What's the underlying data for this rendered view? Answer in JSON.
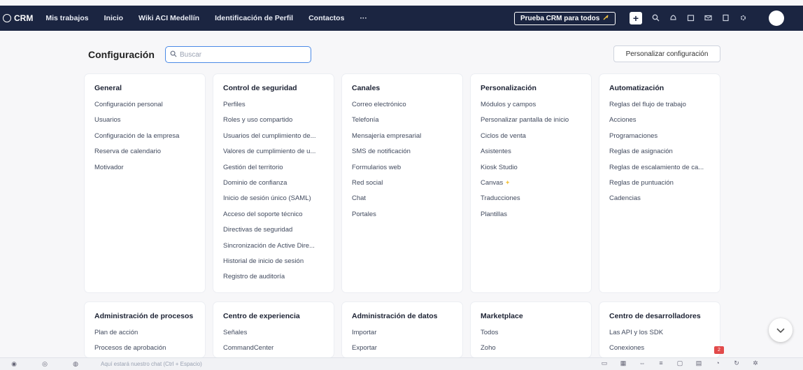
{
  "topbar": {
    "brand": "CRM",
    "nav": [
      "Mis trabajos",
      "Inicio",
      "Wiki ACI Medellín",
      "Identificación de Perfil",
      "Contactos",
      "···"
    ],
    "trial_button": "Prueba CRM para todos",
    "trial_icon": "rocket-icon",
    "add_label": "+",
    "icons": [
      "search-icon",
      "bell-icon",
      "calendar-icon",
      "mail-icon",
      "list-icon",
      "gear-icon"
    ]
  },
  "header": {
    "title": "Configuración",
    "search_placeholder": "Buscar",
    "customize_button": "Personalizar configuración"
  },
  "cards_row1": [
    {
      "title": "General",
      "items": [
        "Configuración personal",
        "Usuarios",
        "Configuración de la empresa",
        "Reserva de calendario",
        "Motivador"
      ]
    },
    {
      "title": "Control de seguridad",
      "items": [
        "Perfiles",
        "Roles y uso compartido",
        "Usuarios del cumplimiento de...",
        "Valores de cumplimiento de u...",
        "Gestión del territorio",
        "Dominio de confianza",
        "Inicio de sesión único (SAML)",
        "Acceso del soporte técnico",
        "Directivas de seguridad",
        "Sincronización de Active Dire...",
        "Historial de inicio de sesión",
        "Registro de auditoría"
      ]
    },
    {
      "title": "Canales",
      "items": [
        "Correo electrónico",
        "Telefonía",
        "Mensajería empresarial",
        "SMS de notificación",
        "Formularios web",
        "Red social",
        "Chat",
        "Portales"
      ]
    },
    {
      "title": "Personalización",
      "items": [
        "Módulos y campos",
        "Personalizar pantalla de inicio",
        "Ciclos de venta",
        "Asistentes",
        "Kiosk Studio",
        "Canvas",
        "Traducciones",
        "Plantillas"
      ]
    },
    {
      "title": "Automatización",
      "items": [
        "Reglas del flujo de trabajo",
        "Acciones",
        "Programaciones",
        "Reglas de asignación",
        "Reglas de escalamiento de ca...",
        "Reglas de puntuación",
        "Cadencias"
      ]
    }
  ],
  "cards_row2": [
    {
      "title": "Administración de procesos",
      "items": [
        "Plan de acción",
        "Procesos de aprobación"
      ]
    },
    {
      "title": "Centro de experiencia",
      "items": [
        "Señales",
        "CommandCenter"
      ]
    },
    {
      "title": "Administración de datos",
      "items": [
        "Importar",
        "Exportar"
      ]
    },
    {
      "title": "Marketplace",
      "items": [
        "Todos",
        "Zoho"
      ]
    },
    {
      "title": "Centro de desarrolladores",
      "items": [
        "Las API y los SDK",
        "Conexiones"
      ]
    }
  ],
  "canvas_badge_icon": "sparkle-icon",
  "bottombar": {
    "input_placeholder": "Aquí estará nuestro chat (Ctrl + Espacio)",
    "left_icons": [
      "chat-icon",
      "channel-icon",
      "contacts-icon"
    ],
    "right_icons": [
      "note-icon",
      "grid-icon",
      "link-icon",
      "list-icon",
      "calendar-icon",
      "inbox-icon",
      "clock-icon",
      "refresh-icon",
      "settings-icon"
    ],
    "notification_count": "2"
  },
  "accent_color": "#4b8ae6",
  "topbar_color": "#1b2541"
}
